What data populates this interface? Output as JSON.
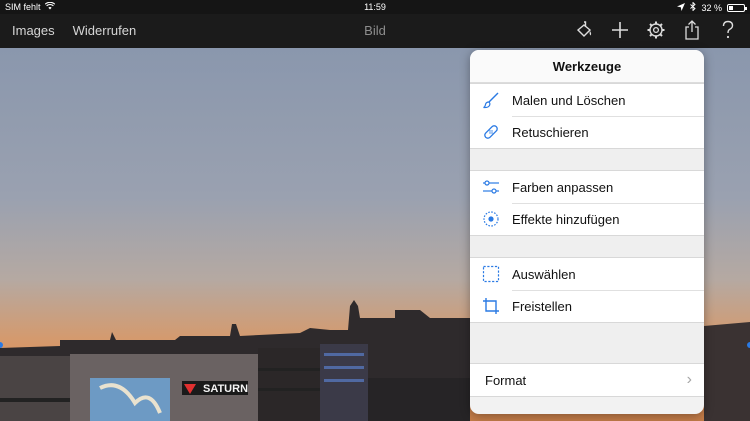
{
  "status": {
    "carrier": "SIM fehlt",
    "time": "11:59",
    "battery_percent": "32 %",
    "battery_level": 0.32
  },
  "navbar": {
    "images_label": "Images",
    "undo_label": "Widerrufen",
    "title": "Bild",
    "icons": [
      "brush-bucket-icon",
      "plus-icon",
      "gear-icon",
      "share-icon",
      "help-icon"
    ]
  },
  "photo": {
    "signs": {
      "store_sign": "SATURN"
    }
  },
  "popover": {
    "title": "Werkzeuge",
    "groups": [
      {
        "items": [
          {
            "label": "Malen und Löschen",
            "icon": "brush-icon"
          },
          {
            "label": "Retuschieren",
            "icon": "bandage-icon"
          }
        ]
      },
      {
        "items": [
          {
            "label": "Farben anpassen",
            "icon": "sliders-icon"
          },
          {
            "label": "Effekte hinzufügen",
            "icon": "effects-icon"
          }
        ]
      },
      {
        "items": [
          {
            "label": "Auswählen",
            "icon": "selection-icon"
          },
          {
            "label": "Freistellen",
            "icon": "crop-icon"
          }
        ]
      }
    ],
    "format_label": "Format"
  },
  "colors": {
    "accent": "#2a7ae4",
    "navbar_bg": "#1b1b1b",
    "popover_bg": "#f2f2f2"
  }
}
